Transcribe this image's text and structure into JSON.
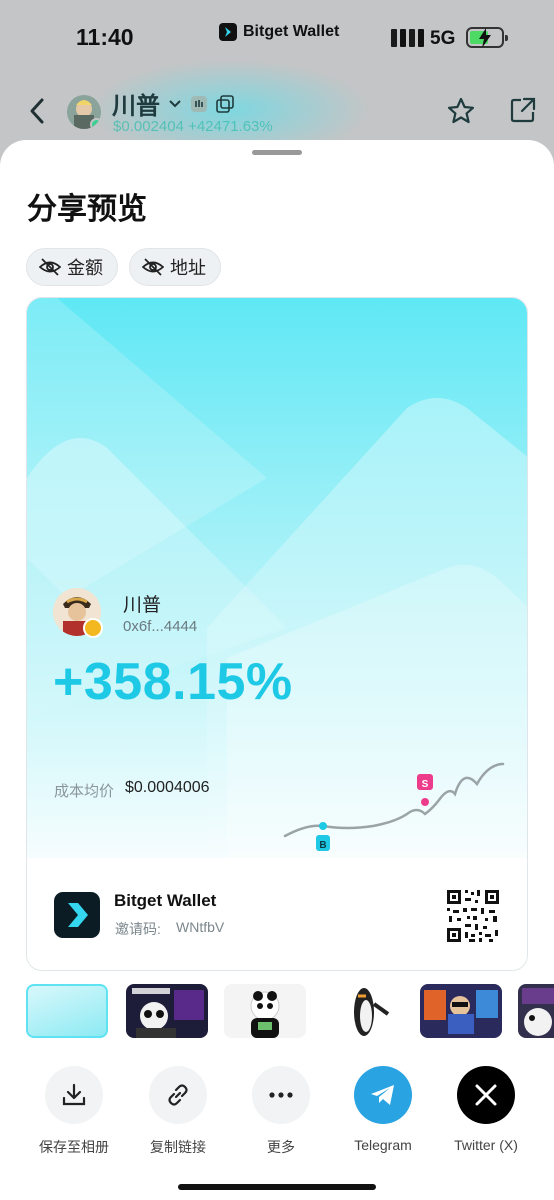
{
  "status_bar": {
    "time": "11:40",
    "carrier_brand": "Bitget Wallet",
    "network": "5G"
  },
  "token_header": {
    "name": "川普",
    "price": "$0.002404",
    "change": "+42471.63%",
    "icons": [
      "back-icon",
      "chevron-down-icon",
      "hand-icon",
      "copy-icon",
      "star-icon",
      "share-icon"
    ]
  },
  "sheet": {
    "title": "分享预览",
    "toggles": [
      {
        "label": "金额",
        "icon": "eye-off-icon"
      },
      {
        "label": "地址",
        "icon": "eye-off-icon"
      }
    ]
  },
  "card": {
    "user_name": "川普",
    "user_address": "0x6f...4444",
    "pnl_percent": "+358.15%",
    "cost_label": "成本均价",
    "cost_value": "$0.0004006",
    "chart_markers": {
      "buy": "B",
      "sell": "S"
    },
    "footer": {
      "app_name": "Bitget Wallet",
      "invite_label": "邀请码:",
      "invite_code": "WNtfbV"
    },
    "accent_color": "#1ec9e6"
  },
  "thumbnails": [
    {
      "name": "thumb-cyan",
      "selected": true
    },
    {
      "name": "thumb-panda-neon",
      "selected": false
    },
    {
      "name": "thumb-panda-cash",
      "selected": false
    },
    {
      "name": "thumb-penguin",
      "selected": false
    },
    {
      "name": "thumb-gamer-room",
      "selected": false
    },
    {
      "name": "thumb-penguin-partial",
      "selected": false
    }
  ],
  "actions": [
    {
      "label": "保存至相册",
      "icon": "download-icon"
    },
    {
      "label": "复制链接",
      "icon": "link-icon"
    },
    {
      "label": "更多",
      "icon": "more-icon"
    },
    {
      "label": "Telegram",
      "icon": "telegram-icon"
    },
    {
      "label": "Twitter (X)",
      "icon": "x-icon"
    }
  ]
}
